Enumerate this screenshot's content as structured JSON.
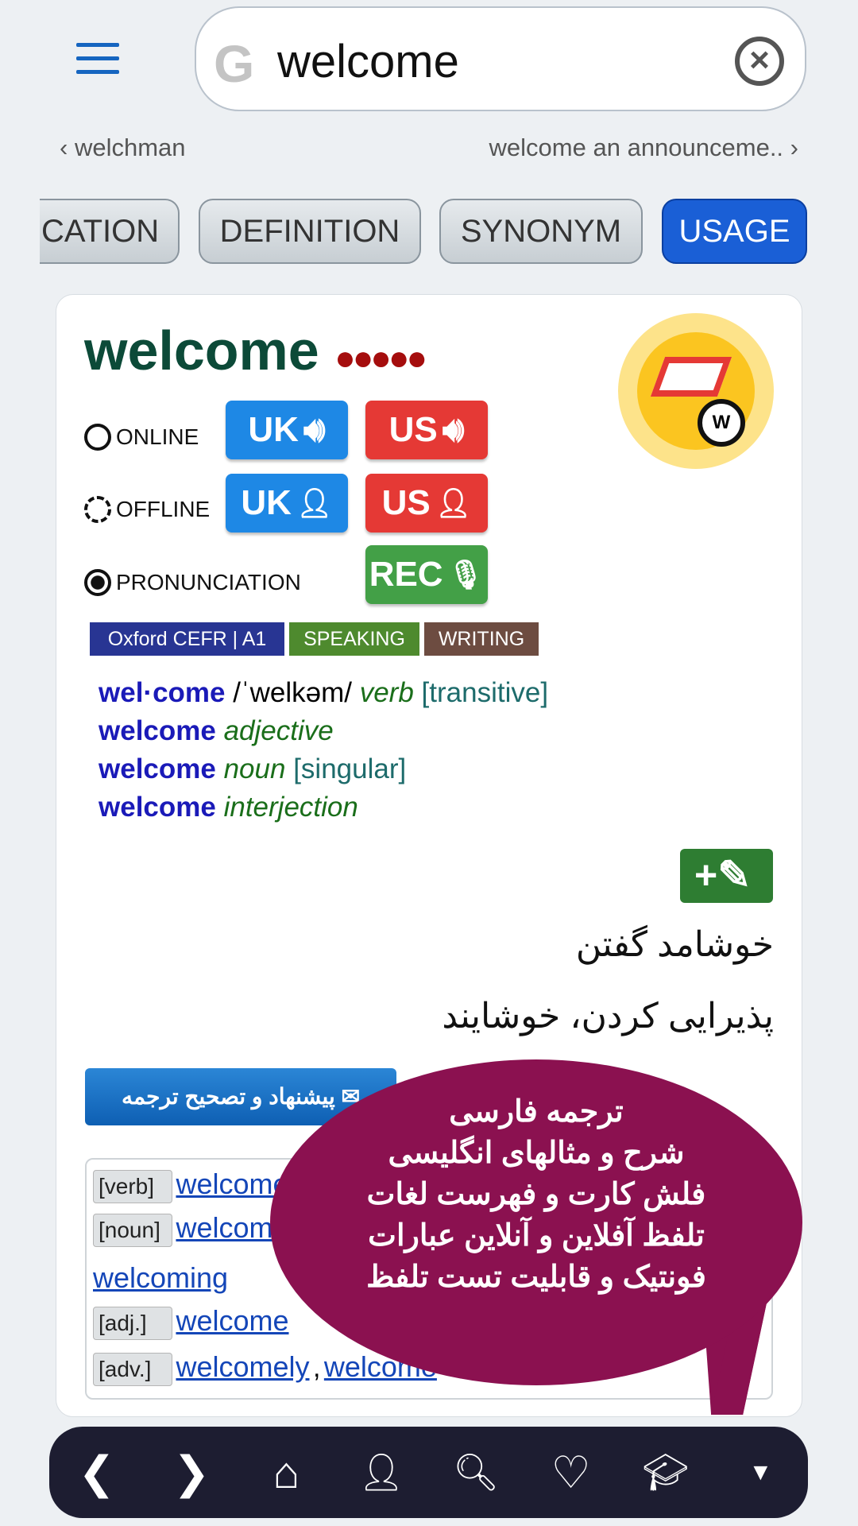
{
  "search": {
    "value": "welcome",
    "g_letter": "G"
  },
  "nav": {
    "prev": "welchman",
    "next": "welcome an announceme.."
  },
  "tabs": [
    {
      "label": "CATION"
    },
    {
      "label": "DEFINITION"
    },
    {
      "label": "SYNONYM"
    },
    {
      "label": "USAGE",
      "active": true
    }
  ],
  "entry": {
    "word": "welcome",
    "dots": "●●●●●",
    "rows": {
      "online": "ONLINE",
      "offline": "OFFLINE",
      "pronunciation": "PRONUNCIATION"
    },
    "buttons": {
      "uk": "UK",
      "us": "US",
      "rec": "REC"
    },
    "badges": [
      {
        "label": "Oxford CEFR | A1",
        "color": "#283593"
      },
      {
        "label": "SPEAKING",
        "color": "#4e8a2e"
      },
      {
        "label": "WRITING",
        "color": "#6d4c41"
      }
    ],
    "definitions": [
      {
        "word": "wel·come",
        "phon": "/ˈwelkəm/",
        "pos": "verb",
        "gram": "[transitive]"
      },
      {
        "word": "welcome",
        "pos": "adjective"
      },
      {
        "word": "welcome",
        "pos": "noun",
        "gram": "[singular]"
      },
      {
        "word": "welcome",
        "pos": "interjection"
      }
    ],
    "translations": [
      "خوشامد گفتن",
      "پذیرایی کردن، خوشایند"
    ],
    "suggest_label": "پیشنهاد و تصحیح ترجمه",
    "forms": [
      {
        "tag": "[verb]",
        "links": "welcome"
      },
      {
        "tag": "[noun]",
        "links": "welcome"
      },
      {
        "extra": "welcoming"
      },
      {
        "tag": "[adj.]",
        "links": "welcome"
      },
      {
        "tag": "[adv.]",
        "links": "welcomely",
        "links2": "welcome"
      }
    ],
    "logo_letter": "W"
  },
  "bubble": [
    "ترجمه فارسی",
    "شرح و مثالهای انگلیسی",
    "فلش کارت و فهرست لغات",
    "تلفظ آفلاین و آنلاین عبارات",
    "فونتیک و قابلیت تست تلفظ"
  ],
  "colors": {
    "accent": "#1a5fd6",
    "bubble": "#8b1150",
    "navbar": "#1d1d31"
  },
  "bottom_nav": [
    "back",
    "forward",
    "home",
    "speak",
    "search-doc",
    "favorite",
    "learn",
    "more"
  ]
}
